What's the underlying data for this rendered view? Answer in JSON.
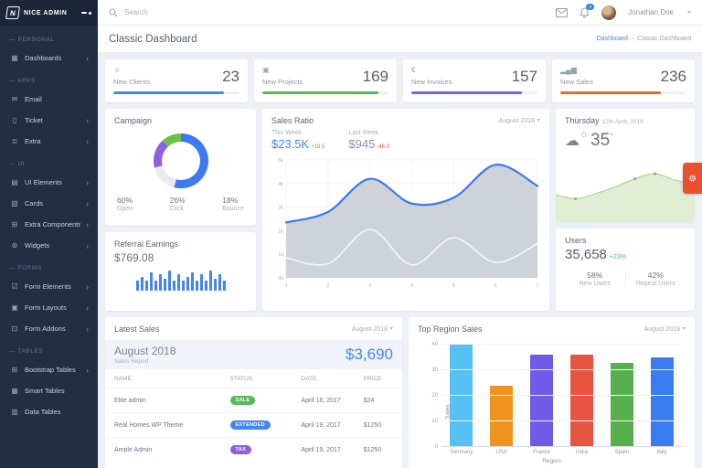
{
  "app": {
    "brand": "NICE ADMIN",
    "brand_initial": "N",
    "page_title": "Classic Dashboard"
  },
  "topbar": {
    "search_placeholder": "Search",
    "notification_count": "3",
    "user_name": "Jonathan Doe"
  },
  "breadcrumb": {
    "home": "Dashboard",
    "current": "Classic Dashboard"
  },
  "sidebar": {
    "sections": [
      {
        "label": "PERSONAL",
        "items": [
          {
            "label": "Dashboards",
            "icon": "grid-icon",
            "chevron": true
          }
        ]
      },
      {
        "label": "APPS",
        "items": [
          {
            "label": "Email",
            "icon": "envelope-icon",
            "chevron": false
          },
          {
            "label": "Ticket",
            "icon": "ticket-icon",
            "chevron": true
          },
          {
            "label": "Extra",
            "icon": "layers-icon",
            "chevron": true
          }
        ]
      },
      {
        "label": "UI",
        "items": [
          {
            "label": "UI Elements",
            "icon": "ui-elements-icon",
            "chevron": true
          },
          {
            "label": "Cards",
            "icon": "cards-icon",
            "chevron": true
          },
          {
            "label": "Extra Components",
            "icon": "components-icon",
            "chevron": true
          },
          {
            "label": "Widgets",
            "icon": "widgets-icon",
            "chevron": true
          }
        ]
      },
      {
        "label": "FORMS",
        "items": [
          {
            "label": "Form Elements",
            "icon": "form-elements-icon",
            "chevron": true
          },
          {
            "label": "Form Layouts",
            "icon": "form-layouts-icon",
            "chevron": true
          },
          {
            "label": "Form Addons",
            "icon": "form-addons-icon",
            "chevron": true
          }
        ]
      },
      {
        "label": "TABLES",
        "items": [
          {
            "label": "Bootstrap Tables",
            "icon": "bootstrap-tables-icon",
            "chevron": true
          },
          {
            "label": "Smart Tables",
            "icon": "smart-tables-icon",
            "chevron": false
          },
          {
            "label": "Data Tables",
            "icon": "data-tables-icon",
            "chevron": false
          }
        ]
      }
    ]
  },
  "stats": [
    {
      "label": "New Clients",
      "value": "23",
      "icon": "smiley-icon",
      "color": "#4285f4",
      "progress": 88
    },
    {
      "label": "New Projects",
      "value": "169",
      "icon": "window-icon",
      "color": "#5cb65c",
      "progress": 92
    },
    {
      "label": "New Invoices",
      "value": "157",
      "icon": "euro-icon",
      "color": "#7b5fe8",
      "progress": 88
    },
    {
      "label": "New Sales",
      "value": "236",
      "icon": "bar-chart-icon",
      "color": "#ee6a2c",
      "progress": 80
    }
  ],
  "campaign": {
    "title": "Campaign",
    "stats": [
      {
        "value": "60%",
        "label": "Open"
      },
      {
        "value": "26%",
        "label": "Click"
      },
      {
        "value": "18%",
        "label": "Bounce"
      }
    ]
  },
  "referral": {
    "title": "Referral Earnings",
    "value": "$769.08"
  },
  "sales_ratio": {
    "title": "Sales Ratio",
    "period": "August 2018",
    "this_week_label": "This Week",
    "this_week_value": "$23.5K",
    "this_week_delta": "+18.5",
    "last_week_label": "Last Week",
    "last_week_value": "$945",
    "last_week_delta": "-46.3"
  },
  "weather": {
    "day": "Thursday",
    "date": "12th April, 2018",
    "temp": "35"
  },
  "users": {
    "title": "Users",
    "value": "35,658",
    "delta": "+23%",
    "splits": [
      {
        "value": "58%",
        "label": "New Users"
      },
      {
        "value": "42%",
        "label": "Repeat Users"
      }
    ]
  },
  "latest_sales": {
    "title": "Latest Sales",
    "period": "August 2018",
    "banner": {
      "month": "August 2018",
      "subtitle": "Sales Report",
      "total": "$3,690"
    },
    "columns": [
      "NAME",
      "STATUS",
      "DATE",
      "PRICE"
    ],
    "rows": [
      {
        "name": "Elite admin",
        "status": "SALE",
        "status_color": "#5cb65c",
        "date": "April 18, 2017",
        "price": "$24"
      },
      {
        "name": "Real Homes WP Theme",
        "status": "EXTENDED",
        "status_color": "#4285f4",
        "date": "April 19, 2017",
        "price": "$1250"
      },
      {
        "name": "Ample Admin",
        "status": "TAX",
        "status_color": "#8e5fe0",
        "date": "April 19, 2017",
        "price": "$1250"
      }
    ]
  },
  "top_region": {
    "title": "Top Region Sales",
    "period": "August 2018"
  },
  "chart_data": [
    {
      "id": "campaign_donut",
      "type": "pie",
      "segments": [
        {
          "label": "Open",
          "pct": 54,
          "color": "#3e79f0"
        },
        {
          "label": "Remainder",
          "pct": 17,
          "color": "#e8ebf0"
        },
        {
          "label": "Click",
          "pct": 17,
          "color": "#8e5fe0"
        },
        {
          "label": "Bounce",
          "pct": 12,
          "color": "#6cc04a"
        }
      ]
    },
    {
      "id": "referral_spark",
      "type": "bar",
      "values": [
        5,
        7,
        5,
        9,
        5,
        8,
        6,
        10,
        5,
        8,
        5,
        7,
        9,
        5,
        8,
        5,
        10,
        6,
        8,
        5
      ],
      "color": "#4285f4"
    },
    {
      "id": "sales_ratio",
      "type": "area",
      "x": [
        1,
        2,
        3,
        4,
        5,
        6,
        7
      ],
      "series": [
        {
          "name": "sales",
          "values": [
            2.35,
            2.8,
            4.2,
            3.15,
            3.4,
            4.8,
            3.9
          ]
        },
        {
          "name": "secondary",
          "values": [
            0.85,
            0.6,
            2.05,
            0.55,
            1.7,
            0.65,
            1.45
          ]
        }
      ],
      "ylim": [
        0,
        5
      ],
      "yticks": [
        "0k",
        "1k",
        "2k",
        "3k",
        "4k",
        "5k"
      ],
      "line_color": "#3e79f0",
      "area_color": "#c9ced6",
      "secondary_color": "#ffffff",
      "grid": true
    },
    {
      "id": "weather_area",
      "type": "area",
      "values": [
        4.8,
        3.9,
        5.0,
        6.5,
        8.3,
        9.4,
        8.0,
        7.0
      ],
      "dots": [
        1,
        4,
        5
      ],
      "ylim": [
        0,
        10
      ],
      "area_color": "#e2eed4",
      "line_color": "#b5d49a",
      "dot_color": "#90b873"
    },
    {
      "id": "top_region",
      "type": "bar",
      "categories": [
        "Germany",
        "USA",
        "France",
        "India",
        "Spain",
        "Italy"
      ],
      "values": [
        40,
        24,
        36,
        36,
        33,
        35
      ],
      "colors": [
        "#56c2f4",
        "#f0941f",
        "#6f5be8",
        "#e85442",
        "#56b04c",
        "#3a7df0"
      ],
      "xlabel": "Region",
      "ylabel": "Sales",
      "ylim": [
        0,
        40
      ],
      "yticks": [
        0,
        10,
        20,
        30,
        40
      ],
      "grid": true
    }
  ]
}
